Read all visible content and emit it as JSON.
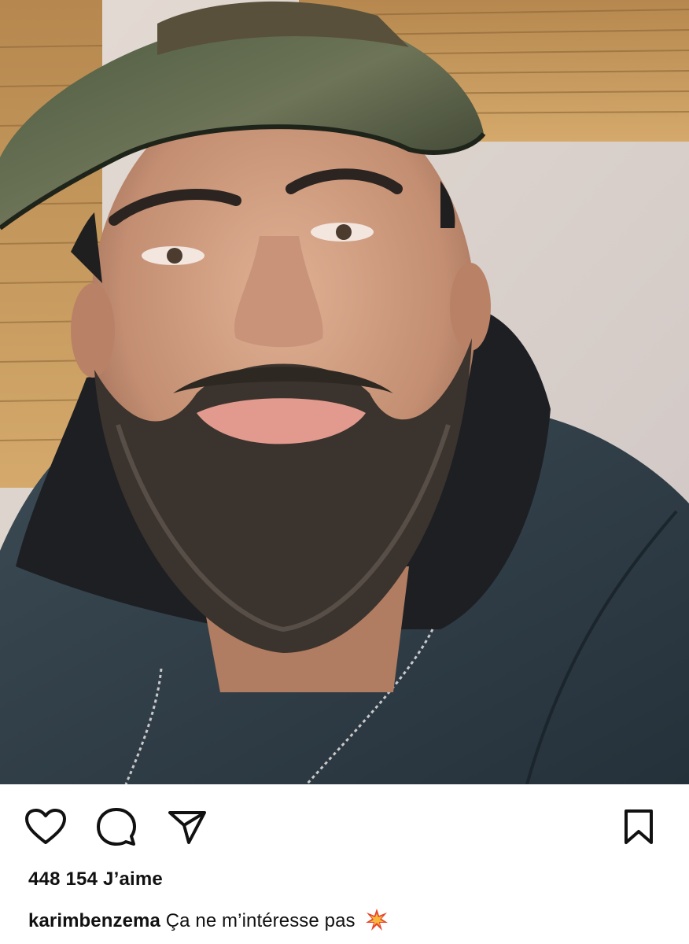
{
  "post": {
    "image_alt": "Selfie of a bearded man wearing a camouflage cap and dark hoodie",
    "likes_count": "448 154",
    "likes_label": "J’aime",
    "username": "karimbenzema",
    "caption_text": "Ça ne m’intéresse pas"
  },
  "icons": {
    "like": "heart-icon",
    "comment": "comment-bubble-icon",
    "share": "paper-plane-icon",
    "save": "bookmark-icon",
    "caption_emoji": "collision-emoji"
  },
  "colors": {
    "text": "#111111",
    "background": "#ffffff",
    "icon_stroke": "#111111",
    "emoji_primary": "#e8442a",
    "emoji_secondary": "#f6b73c"
  }
}
